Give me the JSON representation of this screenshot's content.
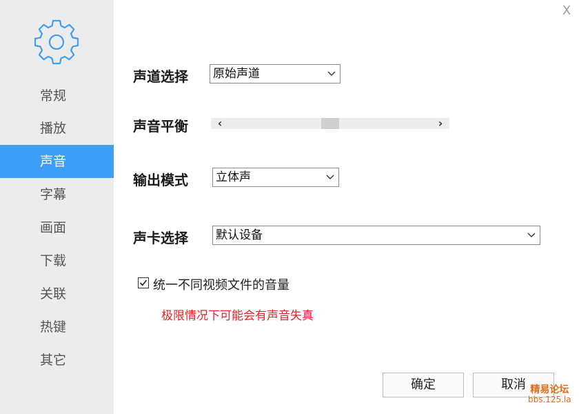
{
  "window": {
    "close_label": "X"
  },
  "sidebar": {
    "logo_icon": "gear-icon",
    "items": [
      {
        "label": "常规",
        "active": false
      },
      {
        "label": "播放",
        "active": false
      },
      {
        "label": "声音",
        "active": true
      },
      {
        "label": "字幕",
        "active": false
      },
      {
        "label": "画面",
        "active": false
      },
      {
        "label": "下载",
        "active": false
      },
      {
        "label": "关联",
        "active": false
      },
      {
        "label": "热键",
        "active": false
      },
      {
        "label": "其它",
        "active": false
      }
    ]
  },
  "main": {
    "channel": {
      "label": "声道选择",
      "value": "原始声道"
    },
    "balance": {
      "label": "声音平衡",
      "position": 0.5
    },
    "output": {
      "label": "输出模式",
      "value": "立体声"
    },
    "soundcard": {
      "label": "声卡选择",
      "value": "默认设备"
    },
    "unify_volume": {
      "label": "统一不同视频文件的音量",
      "checked": true
    },
    "warning": "极限情况下可能会有声音失真"
  },
  "buttons": {
    "ok": "确定",
    "cancel": "取消"
  },
  "watermark": {
    "line1": "精易论坛",
    "line2": "bbs.125.la"
  },
  "colors": {
    "accent": "#3c9ef5",
    "sidebar_bg": "#ececec",
    "warning": "#e8222a"
  }
}
